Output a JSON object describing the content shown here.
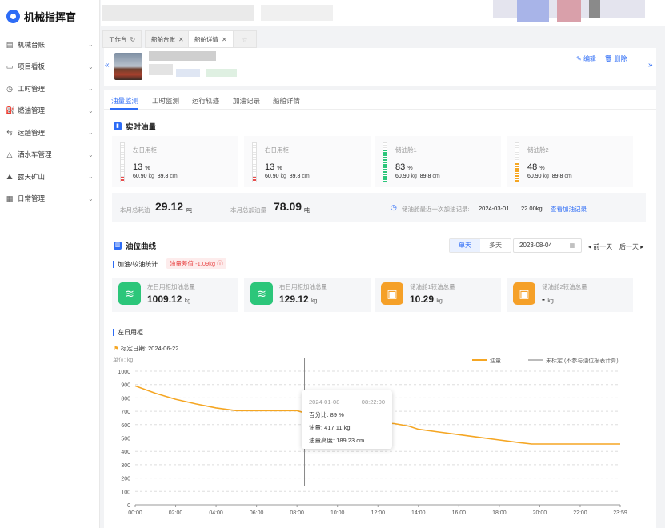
{
  "app": {
    "title": "机械指挥官"
  },
  "sidebar": {
    "items": [
      {
        "label": "机械台账",
        "icon": "ledger-icon"
      },
      {
        "label": "项目看板",
        "icon": "monitor-icon"
      },
      {
        "label": "工时管理",
        "icon": "clock-icon"
      },
      {
        "label": "燃油管理",
        "icon": "fuel-icon"
      },
      {
        "label": "运趟管理",
        "icon": "trip-icon"
      },
      {
        "label": "洒水车管理",
        "icon": "truck-icon"
      },
      {
        "label": "露天矿山",
        "icon": "mountain-icon"
      },
      {
        "label": "日常管理",
        "icon": "calendar-icon"
      }
    ]
  },
  "tabs": [
    {
      "label": "工作台",
      "icon": "refresh-icon"
    },
    {
      "label": "船舶台账",
      "icon": "close-icon"
    },
    {
      "label": "船舶详情",
      "icon": "close-icon"
    }
  ],
  "header": {
    "edit": "编辑",
    "delete": "删除"
  },
  "detail_tabs": [
    "油量监测",
    "工时监测",
    "运行轨迹",
    "加油记录",
    "船舶详情"
  ],
  "realtime": {
    "title": "实时油量",
    "tanks": [
      {
        "name": "左日用柜",
        "pct": "13",
        "unit": "%",
        "oil": "60.90",
        "oil_unit": "kg",
        "height": "89.8",
        "height_unit": "cm",
        "color": "#e94b4b"
      },
      {
        "name": "右日用柜",
        "pct": "13",
        "unit": "%",
        "oil": "60.90",
        "oil_unit": "kg",
        "height": "89.8",
        "height_unit": "cm",
        "color": "#e94b4b"
      },
      {
        "name": "储油舱1",
        "pct": "83",
        "unit": "%",
        "oil": "60.90",
        "oil_unit": "kg",
        "height": "89.8",
        "height_unit": "cm",
        "color": "#2cc67a"
      },
      {
        "name": "储油舱2",
        "pct": "48",
        "unit": "%",
        "oil": "60.90",
        "oil_unit": "kg",
        "height": "89.8",
        "height_unit": "cm",
        "color": "#f5a623"
      }
    ],
    "month_consume_label": "本月总耗油",
    "month_consume": "29.12",
    "month_consume_unit": "吨",
    "month_add_label": "本月总加油量",
    "month_add": "78.09",
    "month_add_unit": "吨",
    "last_refuel_label": "储油舱最近一次加油记录:",
    "last_refuel_date": "2024-03-01",
    "last_refuel_amount": "22.00kg",
    "view_records": "查看加油记录"
  },
  "curve": {
    "title": "油位曲线",
    "single_day": "单天",
    "multi_day": "多天",
    "date": "2023-08-04",
    "prev_day": "前一天",
    "next_day": "后一天",
    "stat_label": "加油/较油统计",
    "diff_badge": "油量差值 -1.09kg",
    "summary": [
      {
        "label": "左日用柜加油总量",
        "value": "1009.12",
        "unit": "kg",
        "color": "#2cc67a"
      },
      {
        "label": "右日用柜加油总量",
        "value": "129.12",
        "unit": "kg",
        "color": "#2cc67a"
      },
      {
        "label": "储油舱1较油总量",
        "value": "10.29",
        "unit": "kg",
        "color": "#f5a028"
      },
      {
        "label": "储油舱2较油总量",
        "value": "-",
        "unit": "kg",
        "color": "#f5a028"
      }
    ],
    "chart_section": "左日用柜",
    "calib_date_label": "标定日期: 2024-06-22"
  },
  "chart_data": {
    "type": "line",
    "ylabel": "单位: kg",
    "ylim": [
      0,
      1000
    ],
    "yticks": [
      0,
      100,
      200,
      300,
      400,
      500,
      600,
      700,
      800,
      900,
      1000
    ],
    "xticks": [
      "00:00",
      "02:00",
      "04:00",
      "06:00",
      "08:00",
      "10:00",
      "12:00",
      "14:00",
      "16:00",
      "18:00",
      "20:00",
      "22:00",
      "23:59"
    ],
    "legend": [
      "油量",
      "未标定 (不参与油位报表计算)"
    ],
    "series": [
      {
        "name": "油量",
        "color": "#f5a623",
        "x": [
          0,
          1,
          2,
          3,
          4,
          5,
          6,
          7,
          8,
          9,
          10,
          11,
          12,
          12.8,
          13.5,
          14,
          15,
          16,
          17,
          18,
          19,
          19.6,
          20,
          21,
          22,
          23,
          23.98
        ],
        "y": [
          890,
          835,
          790,
          755,
          725,
          705,
          705,
          705,
          705,
          660,
          640,
          625,
          615,
          608,
          590,
          565,
          545,
          525,
          505,
          485,
          465,
          455,
          455,
          455,
          455,
          455,
          455
        ]
      }
    ],
    "tooltip": {
      "date": "2024-01-08",
      "time": "08:22:00",
      "pct": "百分比: 89 %",
      "oil": "油量: 417.11 kg",
      "height": "油量高度: 189.23 cm"
    }
  }
}
